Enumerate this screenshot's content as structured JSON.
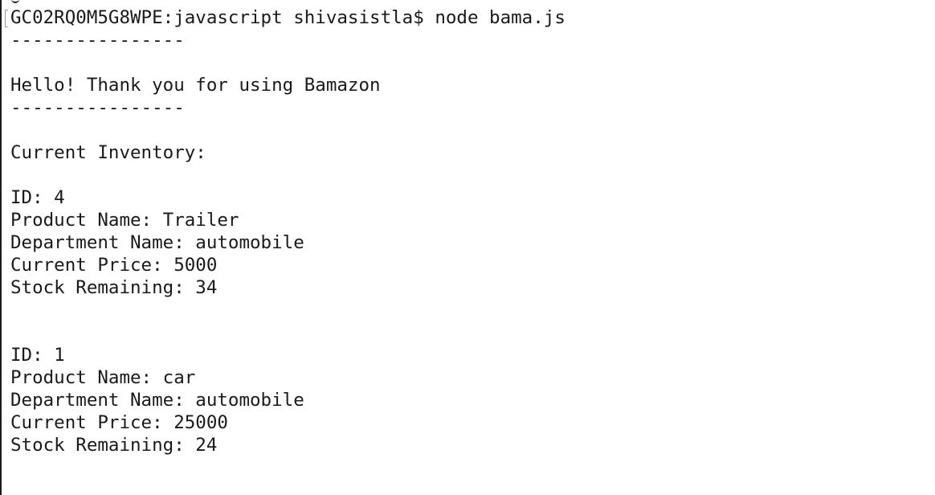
{
  "terminal": {
    "prompt": "GC02RQ0M5G8WPE:javascript shivasistla$",
    "command": "node bama.js",
    "lines": [
      "----------------",
      "",
      "Hello! Thank you for using Bamazon",
      "----------------",
      "",
      "Current Inventory:",
      "",
      "ID: 4",
      "Product Name: Trailer",
      "Department Name: automobile",
      "Current Price: 5000",
      "Stock Remaining: 34",
      "",
      "",
      "ID: 1",
      "Product Name: car",
      "Department Name: automobile",
      "Current Price: 25000",
      "Stock Remaining: 24"
    ]
  }
}
